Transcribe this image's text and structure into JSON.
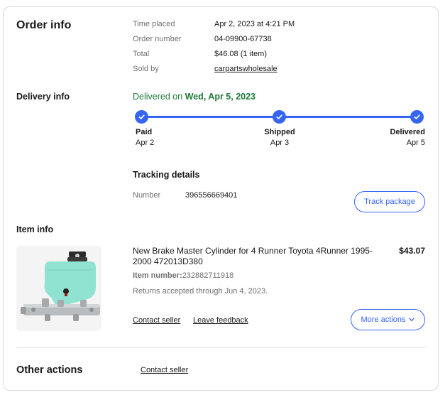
{
  "order_info": {
    "heading": "Order info",
    "rows": [
      {
        "label": "Time placed",
        "value": "Apr 2, 2023 at 4:21 PM"
      },
      {
        "label": "Order number",
        "value": "04-09900-67738"
      },
      {
        "label": "Total",
        "value": "$46.08 (1 item)"
      },
      {
        "label": "Sold by",
        "value": "carpartswholesale"
      }
    ]
  },
  "delivery_info": {
    "heading": "Delivery info",
    "status_prefix": "Delivered on ",
    "status_date": "Wed, Apr 5, 2023",
    "steps": [
      {
        "name": "Paid",
        "date": "Apr 2"
      },
      {
        "name": "Shipped",
        "date": "Apr 3"
      },
      {
        "name": "Delivered",
        "date": "Apr 5"
      }
    ],
    "progress_fraction": 1.0,
    "tracking": {
      "heading": "Tracking details",
      "number_label": "Number",
      "number_value": "396556669401",
      "track_button": "Track package"
    }
  },
  "item_info": {
    "heading": "Item info",
    "title": "New Brake Master Cylinder for 4 Runner Toyota 4Runner 1995-2000 472013D380",
    "price": "$43.07",
    "item_number_label": "Item number:",
    "item_number_value": "232882711918",
    "returns": "Returns accepted through Jun 4, 2023.",
    "contact_seller": "Contact seller",
    "leave_feedback": "Leave feedback",
    "more_actions": "More actions"
  },
  "other_actions": {
    "heading": "Other actions",
    "contact_seller": "Contact seller"
  },
  "colors": {
    "accent": "#3665f3",
    "delivered_green": "#1f7a3a",
    "reservoir": "#8fe3d0"
  },
  "icons": {
    "step": "check-icon",
    "more_actions": "chevron-down-icon"
  }
}
